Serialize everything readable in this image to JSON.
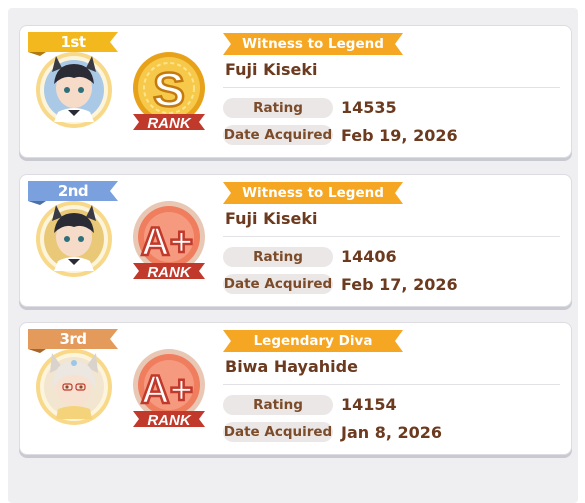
{
  "colors": {
    "title_ribbon": "#f5a623",
    "name_text": "#6b3a1f",
    "gold": "#f2b51e",
    "silver_blue": "#7aa0dd",
    "bronze": "#e39a5a",
    "rank_red": "#d9493a"
  },
  "rankings": [
    {
      "place": "1st",
      "place_color": "#f4b81f",
      "title": "Witness to Legend",
      "name": "Fuji Kiseki",
      "rank_letter": "S",
      "rank_badge_type": "gold",
      "rank_word": "RANK",
      "rating_label": "Rating",
      "rating": "14535",
      "date_label": "Date Acquired",
      "date": "Feb 19, 2026",
      "avatar": "fuji-kiseki-portrait"
    },
    {
      "place": "2nd",
      "place_color": "#7aa0dd",
      "title": "Witness to Legend",
      "name": "Fuji Kiseki",
      "rank_letter": "A+",
      "rank_badge_type": "red",
      "rank_word": "RANK",
      "rating_label": "Rating",
      "rating": "14406",
      "date_label": "Date Acquired",
      "date": "Feb 17, 2026",
      "avatar": "fuji-kiseki-portrait"
    },
    {
      "place": "3rd",
      "place_color": "#e39a5a",
      "title": "Legendary Diva",
      "name": "Biwa Hayahide",
      "rank_letter": "A+",
      "rank_badge_type": "red",
      "rank_word": "RANK",
      "rating_label": "Rating",
      "rating": "14154",
      "date_label": "Date Acquired",
      "date": "Jan 8, 2026",
      "avatar": "biwa-hayahide-portrait"
    }
  ]
}
